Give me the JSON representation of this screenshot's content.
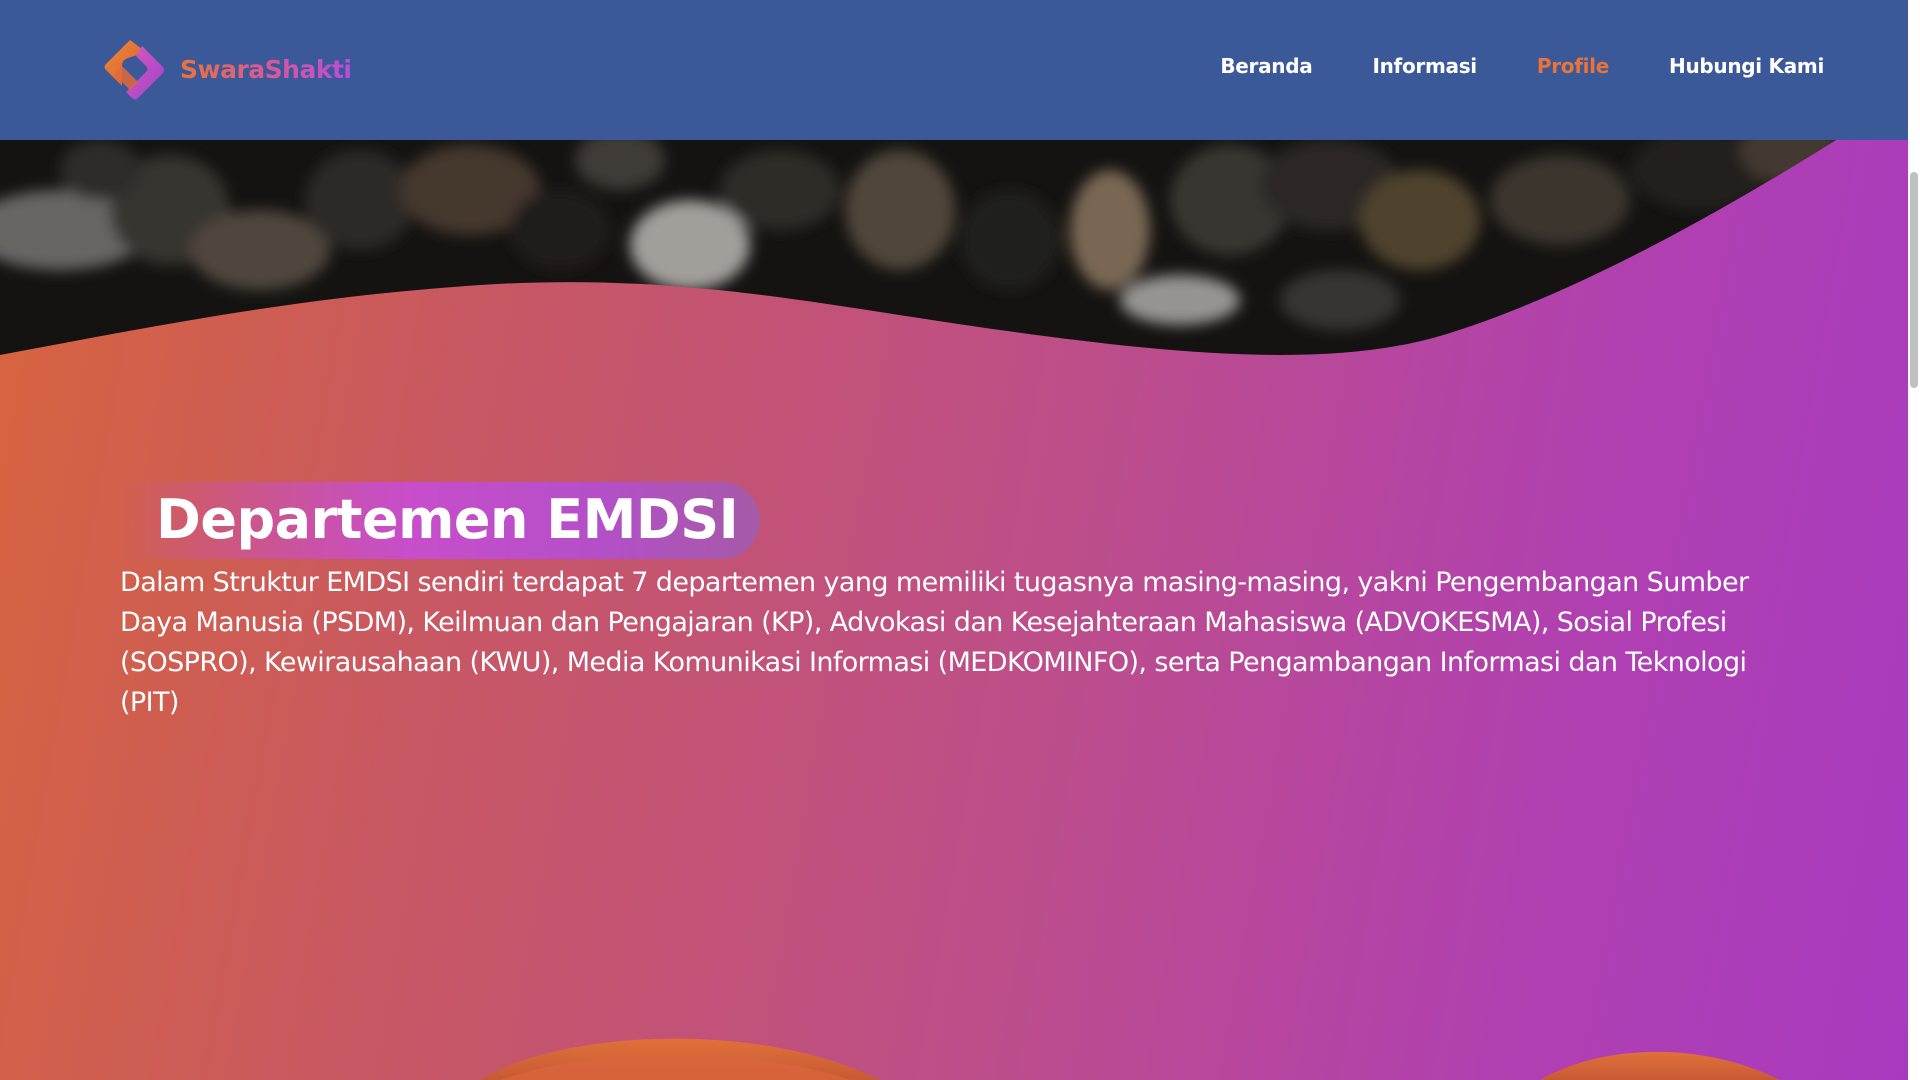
{
  "brand": {
    "name": "SwaraShakti",
    "logo_icon": "diamond-logo-icon"
  },
  "nav": {
    "items": [
      {
        "label": "Beranda",
        "active": false
      },
      {
        "label": "Informasi",
        "active": false
      },
      {
        "label": "Profile",
        "active": true
      },
      {
        "label": "Hubungi Kami",
        "active": false
      }
    ]
  },
  "section": {
    "title": "Departemen EMDSI",
    "body": "Dalam Struktur EMDSI sendiri terdapat 7 departemen yang memiliki tugasnya masing-masing, yakni Pengembangan Sumber Daya Manusia (PSDM), Keilmuan dan Pengajaran (KP), Advokasi dan Kesejahteraan Mahasiswa (ADVOKESMA), Sosial Profesi (SOSPRO), Kewirausahaan (KWU), Media Komunikasi Informasi (MEDKOMINFO), serta Pengambangan Informasi dan Teknologi (PIT)"
  },
  "colors": {
    "navbar": "#3b5998",
    "accent_orange": "#e8743a",
    "accent_purple": "#b040b0",
    "text": "#ffffff"
  }
}
